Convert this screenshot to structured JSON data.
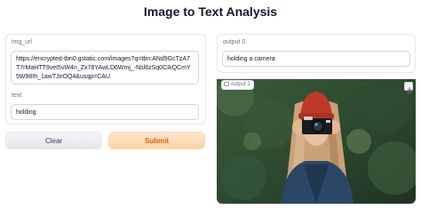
{
  "app": {
    "title": "Image to Text Analysis"
  },
  "inputs": {
    "img_url": {
      "label": "img_url",
      "value": "https://encrypted-tbn0.gstatic.com/images?q=tbn:ANd9GcTzA7T7rMaHTT9veI5vW4n_Zx78YAwLD6Wmj_-Nsl6zSq0CIkQCmY5W98Ih_1awTJirOQ4&usqp=CAU"
    },
    "text": {
      "label": "text",
      "value": "holding"
    }
  },
  "buttons": {
    "clear": "Clear",
    "submit": "Submit"
  },
  "outputs": {
    "output_0": {
      "label": "output 0",
      "value": "holding a camera"
    },
    "output_1": {
      "label": "output 1",
      "image_icon": "image-icon",
      "download_icon": "download-icon"
    }
  },
  "colors": {
    "submit_text": "#ea580c",
    "submit_bg": "#fdd3a8",
    "hat": "#c0392b"
  }
}
